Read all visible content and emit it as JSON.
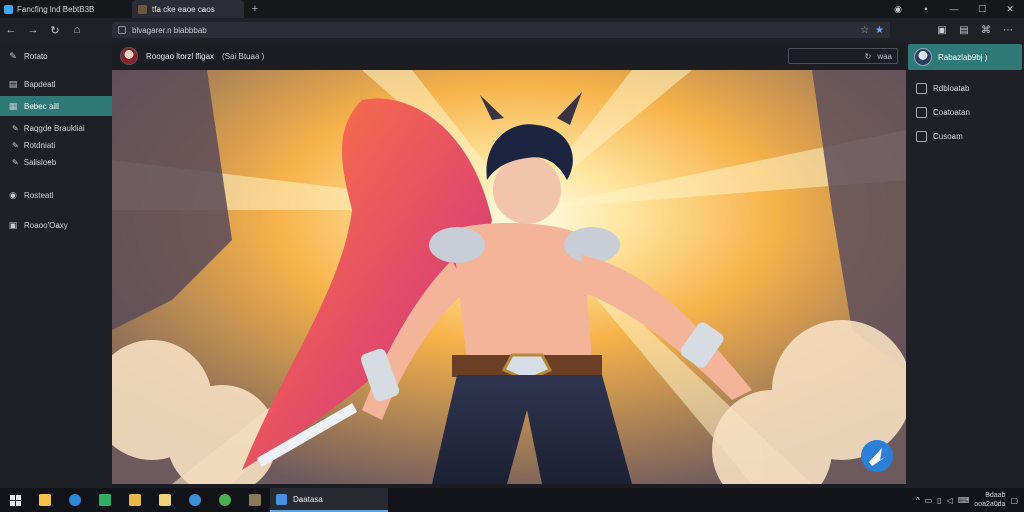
{
  "window": {
    "app_title": "Fancfing lnd BebtB3B",
    "tab_title": "tfa cke eaoe caos",
    "new_tab": "+",
    "controls": [
      "◉",
      "•",
      "—",
      "☐",
      "✕"
    ]
  },
  "nav": {
    "buttons": [
      "←",
      "→",
      "↻",
      "⌂"
    ],
    "address": "blvagarer.n blabbbab",
    "right_icons": [
      "▣",
      "▤",
      "⌘",
      "⋯"
    ]
  },
  "sidebar": {
    "items": [
      {
        "icon": "✎",
        "label": "Rotato"
      },
      {
        "icon": "▤",
        "label": "Bapdeatl"
      },
      {
        "icon": "▦",
        "label": "Bebec ailI",
        "active": true
      }
    ],
    "sub_items": [
      {
        "icon": "✎",
        "label": "Raqgde Braukliai"
      },
      {
        "icon": "✎",
        "label": "Rotdniati"
      },
      {
        "icon": "✎",
        "label": "Salisloeb"
      }
    ],
    "footer_items": [
      {
        "icon": "◉",
        "label": "Rosteatl"
      },
      {
        "icon": "▣",
        "label": "Roaoo'Oaxy"
      }
    ]
  },
  "page": {
    "title": "Roogao ltorzl lfigax",
    "tag": "(Sai Btuaa )",
    "search_text": "waa",
    "search_icon": "↻"
  },
  "right_panel": {
    "header": "Rabazlab9bj )",
    "items": [
      {
        "label": "Rdbloatab"
      },
      {
        "label": "Coatoatan"
      },
      {
        "label": "Cusoam"
      }
    ]
  },
  "taskbar": {
    "active_app": "Daatasa",
    "clock_time": "Bdaab",
    "clock_date": "ooa2a0da"
  }
}
